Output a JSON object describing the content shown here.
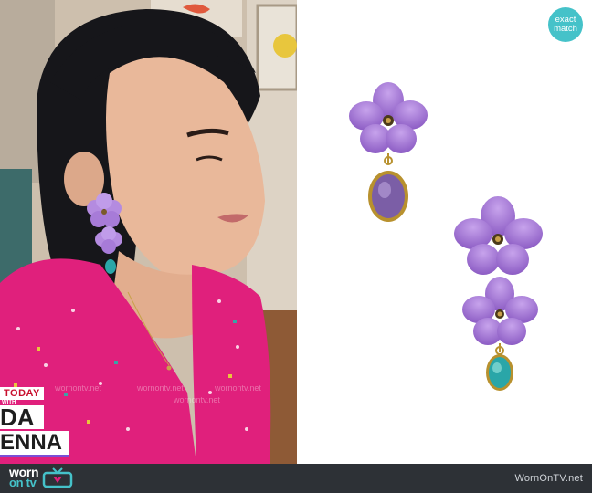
{
  "badge": {
    "line1": "exact",
    "line2": "match"
  },
  "brand": {
    "line1": "worn",
    "line2": "on tv"
  },
  "site_url": "WornOnTV.net",
  "show_logo": {
    "line1": "TODAY",
    "line2": "WITH",
    "line3": "DA",
    "line4": "ENNA"
  },
  "watermarks": [
    "wornontv.net",
    "wornontv.net",
    "wornontv.net",
    "wornontv.net"
  ],
  "colors": {
    "badge": "#45c2c9",
    "bar": "#2d3136",
    "petal": "#9b6bd0",
    "stone_lavender": "#6d4f98",
    "stone_teal": "#2aa6a8",
    "dress": "#e0207c"
  },
  "icons": {
    "tv": "tv-icon",
    "earring_large": "flower-earring-icon"
  }
}
